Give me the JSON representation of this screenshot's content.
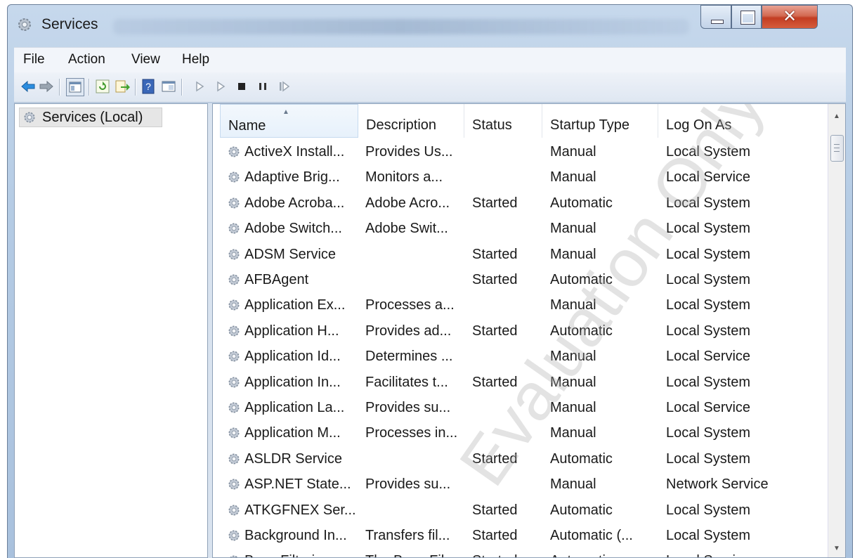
{
  "window": {
    "title": "Services"
  },
  "menu": [
    "File",
    "Action",
    "View",
    "Help"
  ],
  "toolbar": {
    "icons": [
      "back-arrow-icon",
      "forward-arrow-icon",
      "show-hide-console-tree-icon",
      "refresh-icon",
      "export-list-icon",
      "help-icon",
      "properties-icon",
      "start-service-icon",
      "start-service-alt-icon",
      "stop-service-icon",
      "pause-service-icon",
      "resume-service-icon"
    ]
  },
  "tree": {
    "root_label": "Services (Local)"
  },
  "list": {
    "columns": [
      "Name",
      "Description",
      "Status",
      "Startup Type",
      "Log On As"
    ],
    "sorted_column": "Name",
    "rows": [
      [
        "ActiveX Install...",
        "Provides Us...",
        "",
        "Manual",
        "Local System"
      ],
      [
        "Adaptive Brig...",
        "Monitors a...",
        "",
        "Manual",
        "Local Service"
      ],
      [
        "Adobe Acroba...",
        "Adobe Acro...",
        "Started",
        "Automatic",
        "Local System"
      ],
      [
        "Adobe Switch...",
        "Adobe Swit...",
        "",
        "Manual",
        "Local System"
      ],
      [
        "ADSM Service",
        "",
        "Started",
        "Manual",
        "Local System"
      ],
      [
        "AFBAgent",
        "",
        "Started",
        "Automatic",
        "Local System"
      ],
      [
        "Application Ex...",
        "Processes a...",
        "",
        "Manual",
        "Local System"
      ],
      [
        "Application H...",
        "Provides ad...",
        "Started",
        "Automatic",
        "Local System"
      ],
      [
        "Application Id...",
        "Determines ...",
        "",
        "Manual",
        "Local Service"
      ],
      [
        "Application In...",
        "Facilitates t...",
        "Started",
        "Manual",
        "Local System"
      ],
      [
        "Application La...",
        "Provides su...",
        "",
        "Manual",
        "Local Service"
      ],
      [
        "Application M...",
        "Processes in...",
        "",
        "Manual",
        "Local System"
      ],
      [
        "ASLDR Service",
        "",
        "Started",
        "Automatic",
        "Local System"
      ],
      [
        "ASP.NET State...",
        "Provides su...",
        "",
        "Manual",
        "Network Service"
      ],
      [
        "ATKGFNEX Ser...",
        "",
        "Started",
        "Automatic",
        "Local System"
      ],
      [
        "Background In...",
        "Transfers fil...",
        "Started",
        "Automatic (...",
        "Local System"
      ],
      [
        "Base Filtering ...",
        "The Base Fil...",
        "Started",
        "Automatic",
        "Local Service"
      ]
    ]
  },
  "watermark": "Evaluation Only",
  "colors": {
    "title_bg": "#b4cbe4",
    "close_button": "#c33d22",
    "selection": "#e6e6e6"
  }
}
